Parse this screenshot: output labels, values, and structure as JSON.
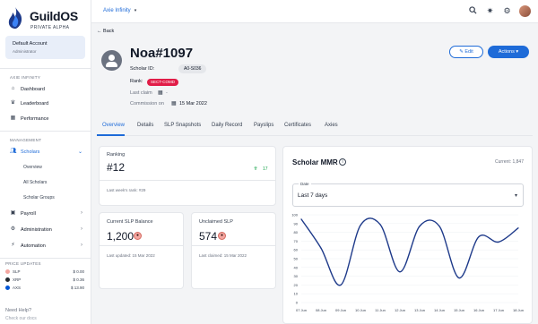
{
  "brand": {
    "name": "GuildOS",
    "tagline": "PRIVATE ALPHA"
  },
  "account": {
    "name": "Default Account",
    "role": "Administrator"
  },
  "sidebar": {
    "section_axie": "AXIE INFINITY",
    "section_management": "MANAGEMENT",
    "section_prices": "PRICE UPDATES",
    "items": [
      {
        "label": "Dashboard",
        "icon": "home-icon"
      },
      {
        "label": "Leaderboard",
        "icon": "trophy-icon"
      },
      {
        "label": "Performance",
        "icon": "chart-icon"
      },
      {
        "label": "Scholars",
        "icon": "users-icon"
      },
      {
        "label": "Payroll",
        "icon": "wallet-icon"
      },
      {
        "label": "Administration",
        "icon": "gear-icon"
      },
      {
        "label": "Automation",
        "icon": "bolt-icon"
      }
    ],
    "scholar_subitems": [
      "Overview",
      "All Scholars",
      "Scholar Groups"
    ],
    "prices": [
      {
        "symbol": "SLP",
        "value": "$ 0.00",
        "color": "#f4a6a0"
      },
      {
        "symbol": "XRP",
        "value": "$ 0.36",
        "color": "#23292f"
      },
      {
        "symbol": "AXS",
        "value": "$ 13.90",
        "color": "#0055d5"
      }
    ],
    "help_label": "Need Help?",
    "docs_label": "Check our docs"
  },
  "topbar": {
    "game": "Axie Infinity"
  },
  "profile": {
    "back_label": "Back",
    "name": "Noa#1097",
    "scholar_id_label": "Scholar ID:",
    "scholar_id": "A0-S036",
    "rank_label": "Rank:",
    "rank_value": "SECT-COMD",
    "last_claim_label": "Last claim",
    "last_claim_value": "-",
    "commission_label": "Commission on",
    "commission_date": "15 Mar 2022",
    "edit_label": "Edit",
    "actions_label": "Actions"
  },
  "tabs": [
    "Overview",
    "Details",
    "SLP Snapshots",
    "Daily Record",
    "Payslips",
    "Certificates",
    "Axies"
  ],
  "ranking": {
    "label": "Ranking",
    "value": "#12",
    "delta": "17",
    "footer": "Last week's rank: #29"
  },
  "current_slp": {
    "label": "Current SLP Balance",
    "value": "1,200",
    "footer": "Last updated: 15 Mar 2022"
  },
  "unclaimed_slp": {
    "label": "Unclaimed SLP",
    "value": "574",
    "footer": "Last claimed: 15 Mar 2022"
  },
  "mmr": {
    "title": "Scholar MMR",
    "current": "Current: 1,847",
    "date_label": "Date",
    "date_value": "Last 7 days"
  },
  "colors": {
    "accent": "#1e6bd8",
    "danger": "#e11d48",
    "line": "#1e3a8a"
  },
  "chart_data": {
    "type": "line",
    "x": [
      "07 Jun",
      "08 Jun",
      "09 Jun",
      "10 Jun",
      "11 Jun",
      "12 Jun",
      "13 Jun",
      "14 Jun",
      "15 Jun",
      "16 Jun",
      "17 Jun",
      "18 Jun"
    ],
    "y_ticks": [
      100,
      90,
      80,
      70,
      60,
      50,
      40,
      30,
      20,
      10,
      0
    ],
    "ylim": [
      0,
      100
    ],
    "series": [
      {
        "values": [
          95,
          62,
          20,
          88,
          89,
          35,
          87,
          87,
          28,
          75,
          69,
          85
        ]
      }
    ]
  }
}
